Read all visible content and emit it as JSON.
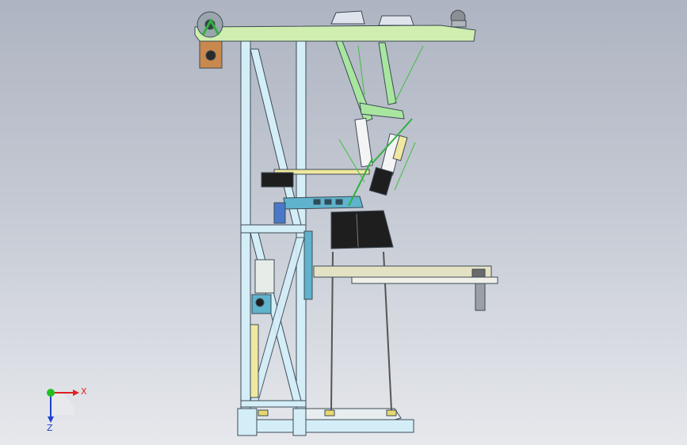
{
  "viewport": {
    "colors": {
      "frame": "#d4eef8",
      "frame_edge": "#3d4a55",
      "top_plate": "#cfeeb0",
      "green_link": "#a8e6a0",
      "cyan_part": "#5fb3cc",
      "yellow_part": "#f0e8a0",
      "dark_part": "#1e1e1e",
      "table": "#e4e2c4"
    }
  },
  "triad": {
    "x_label": "X",
    "z_label": "Z",
    "x_color": "#e02020",
    "y_color": "#20c020",
    "z_color": "#2040d0"
  }
}
